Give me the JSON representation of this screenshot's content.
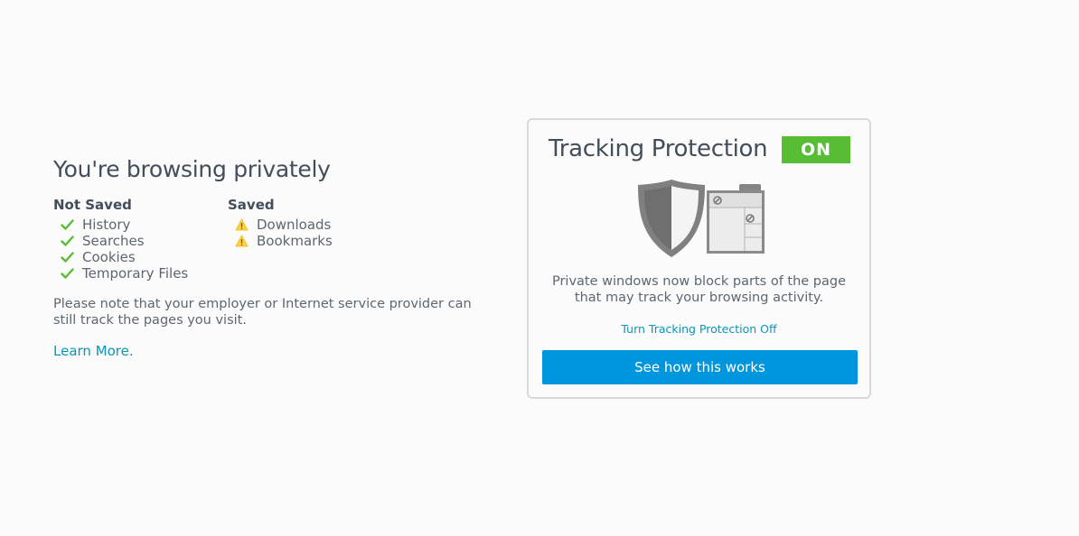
{
  "intro": {
    "title": "You're browsing privately",
    "not_saved": {
      "heading": "Not Saved",
      "icon": "check-icon",
      "items": [
        "History",
        "Searches",
        "Cookies",
        "Temporary Files"
      ]
    },
    "saved": {
      "heading": "Saved",
      "icon": "warning-icon",
      "items": [
        "Downloads",
        "Bookmarks"
      ]
    },
    "note": "Please note that your employer or Internet service provider can still track the pages you visit.",
    "learn_more": "Learn More."
  },
  "tracking": {
    "title": "Tracking Protection",
    "status": "ON",
    "description": "Private windows now block parts of the page that may track your browsing activity.",
    "toggle_link": "Turn Tracking Protection Off",
    "cta_label": "See how this works",
    "illustration": "shield-page-icon"
  },
  "colors": {
    "check": "#57bd35",
    "warning": "#ffd33f",
    "link": "#0996b8",
    "status_on": "#57bd35",
    "cta": "#0096dd"
  }
}
